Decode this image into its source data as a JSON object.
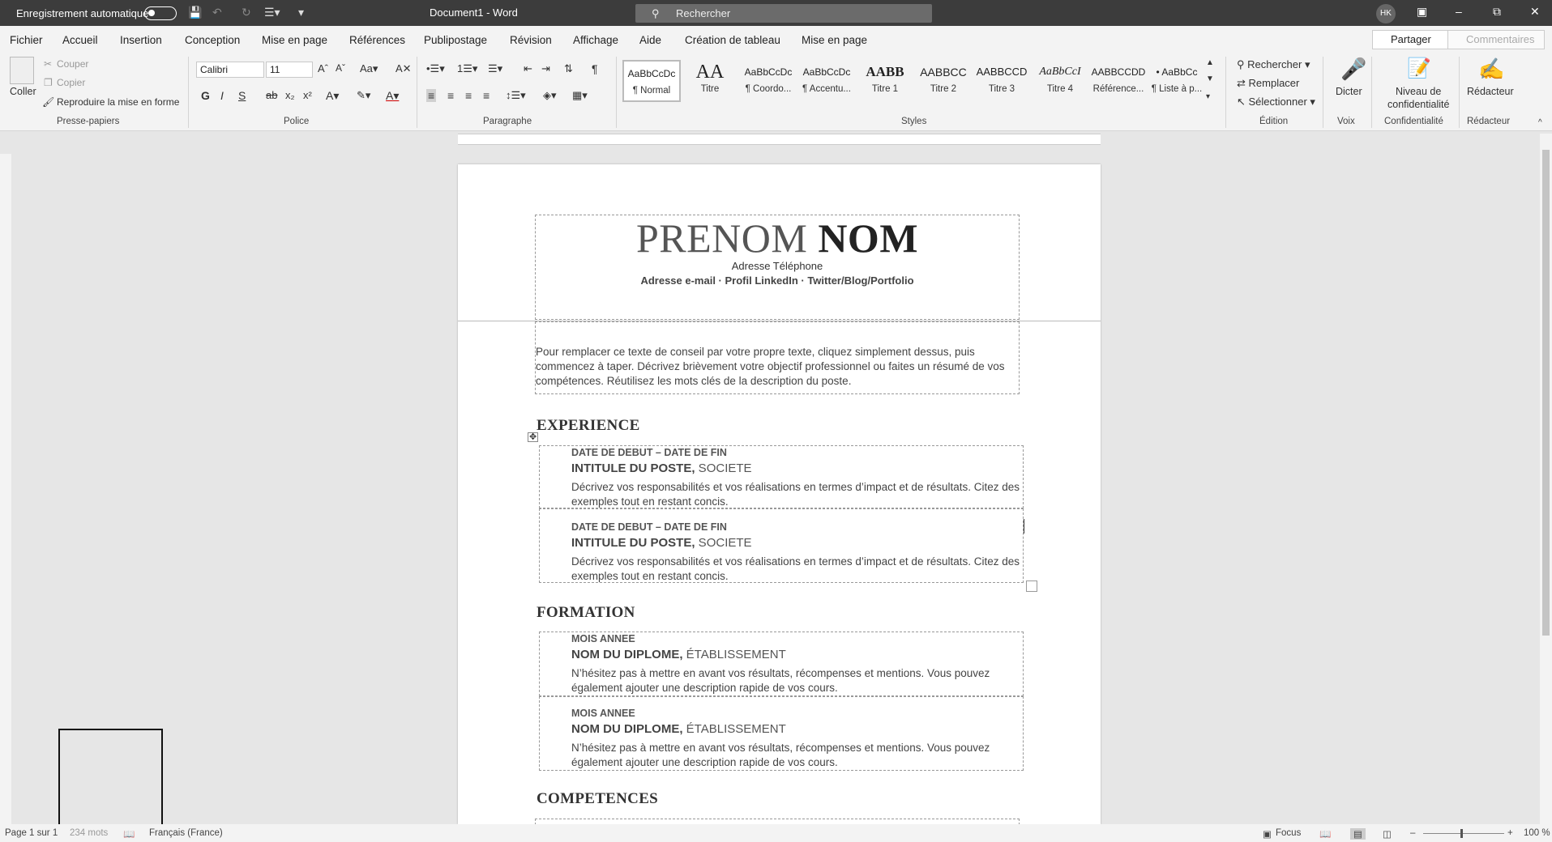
{
  "titlebar": {
    "autosave_label": "Enregistrement automatique",
    "doc_title": "Document1 - Word",
    "search_placeholder": "Rechercher",
    "avatar": "HK"
  },
  "tabs": [
    "Fichier",
    "Accueil",
    "Insertion",
    "Conception",
    "Mise en page",
    "Références",
    "Publipostage",
    "Révision",
    "Affichage",
    "Aide",
    "Création de tableau",
    "Mise en page"
  ],
  "active_tab": "Accueil",
  "share_label": "Partager",
  "comments_label": "Commentaires",
  "clipboard": {
    "paste": "Coller",
    "cut": "Couper",
    "copy": "Copier",
    "format_painter": "Reproduire la mise en forme",
    "group": "Presse-papiers"
  },
  "font": {
    "name": "Calibri",
    "size": "11",
    "group": "Police",
    "bold": "G",
    "italic": "I",
    "underline": "S"
  },
  "paragraph_group": "Paragraphe",
  "styles": {
    "group": "Styles",
    "items": [
      {
        "preview": "AaBbCcDc",
        "name": "¶ Normal"
      },
      {
        "preview": "AA",
        "name": "Titre"
      },
      {
        "preview": "AaBbCcDc",
        "name": "¶ Coordo..."
      },
      {
        "preview": "AaBbCcDc",
        "name": "¶ Accentu..."
      },
      {
        "preview": "AABB",
        "name": "Titre 1"
      },
      {
        "preview": "AABBCC",
        "name": "Titre 2"
      },
      {
        "preview": "AABBCCD",
        "name": "Titre 3"
      },
      {
        "preview": "AaBbCcI",
        "name": "Titre 4"
      },
      {
        "preview": "AABBCCDD",
        "name": "Référence..."
      },
      {
        "preview": "• AaBbCc",
        "name": "¶ Liste à p..."
      }
    ]
  },
  "editing": {
    "group": "Édition",
    "find": "Rechercher",
    "replace": "Remplacer",
    "select": "Sélectionner"
  },
  "voice": {
    "group": "Voix",
    "dictate": "Dicter"
  },
  "confidentiality": {
    "group": "Confidentialité",
    "level": "Niveau de",
    "level2": "confidentialité"
  },
  "editor": {
    "group": "Rédacteur",
    "label": "Rédacteur"
  },
  "document": {
    "first_name": "PRENOM",
    "last_name": "NOM",
    "contact_line1": "Adresse   Téléphone",
    "contact_line2": "Adresse e-mail · Profil LinkedIn · Twitter/Blog/Portfolio",
    "summary": "Pour remplacer ce texte de conseil par votre propre texte, cliquez simplement dessus, puis commencez à taper. Décrivez brièvement votre objectif professionnel ou faites un résumé de vos compétences. Réutilisez les mots clés de la description du poste.",
    "experience_heading": "EXPERIENCE",
    "experience": [
      {
        "date": "DATE DE DEBUT – DATE DE FIN",
        "title": "INTITULE DU POSTE,",
        "org": " SOCIETE",
        "desc": "Décrivez vos responsabilités et vos réalisations en termes d’impact et de résultats. Citez des exemples tout en restant concis."
      },
      {
        "date": "DATE DE DEBUT – DATE DE FIN",
        "title": "INTITULE DU POSTE,",
        "org": " SOCIETE",
        "desc": "Décrivez vos responsabilités et vos réalisations en termes d’impact et de résultats. Citez des exemples tout en restant concis."
      }
    ],
    "education_heading": "FORMATION",
    "education": [
      {
        "date": "MOIS ANNEE",
        "title": "NOM DU DIPLOME,",
        "org": " ÉTABLISSEMENT",
        "desc": "N’hésitez pas à mettre en avant vos résultats, récompenses et mentions. Vous pouvez également ajouter une description rapide de vos cours."
      },
      {
        "date": "MOIS ANNEE",
        "title": "NOM DU DIPLOME,",
        "org": " ÉTABLISSEMENT",
        "desc": "N’hésitez pas à mettre en avant vos résultats, récompenses et mentions. Vous pouvez également ajouter une description rapide de vos cours."
      }
    ],
    "skills_heading": "COMPETENCES"
  },
  "statusbar": {
    "page": "Page 1 sur 1",
    "words": "234 mots",
    "language": "Français (France)",
    "focus": "Focus",
    "zoom": "100 %"
  }
}
